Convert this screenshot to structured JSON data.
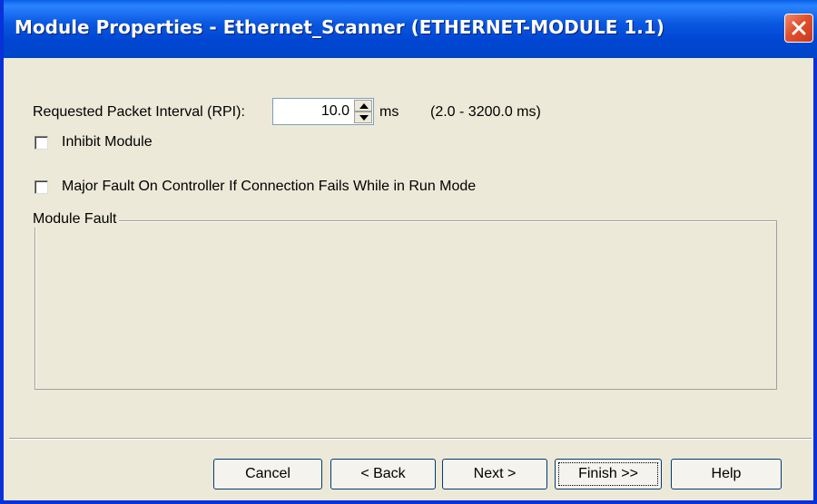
{
  "window": {
    "title": "Module Properties - Ethernet_Scanner (ETHERNET-MODULE 1.1)",
    "title_bar_color": "#0a58e0",
    "close_button_color": "#e0502e"
  },
  "rpi": {
    "label": "Requested Packet Interval (RPI):",
    "value": "10.0",
    "unit": "ms",
    "range": "(2.0 - 3200.0 ms)"
  },
  "options": {
    "inhibit_module": {
      "label": "Inhibit Module",
      "checked": false
    },
    "major_fault": {
      "label": "Major Fault On Controller If Connection Fails While in Run Mode",
      "checked": false
    }
  },
  "module_fault": {
    "title": "Module Fault"
  },
  "buttons": {
    "cancel": "Cancel",
    "back": "< Back",
    "next": "Next >",
    "finish": "Finish >>",
    "help": "Help"
  }
}
